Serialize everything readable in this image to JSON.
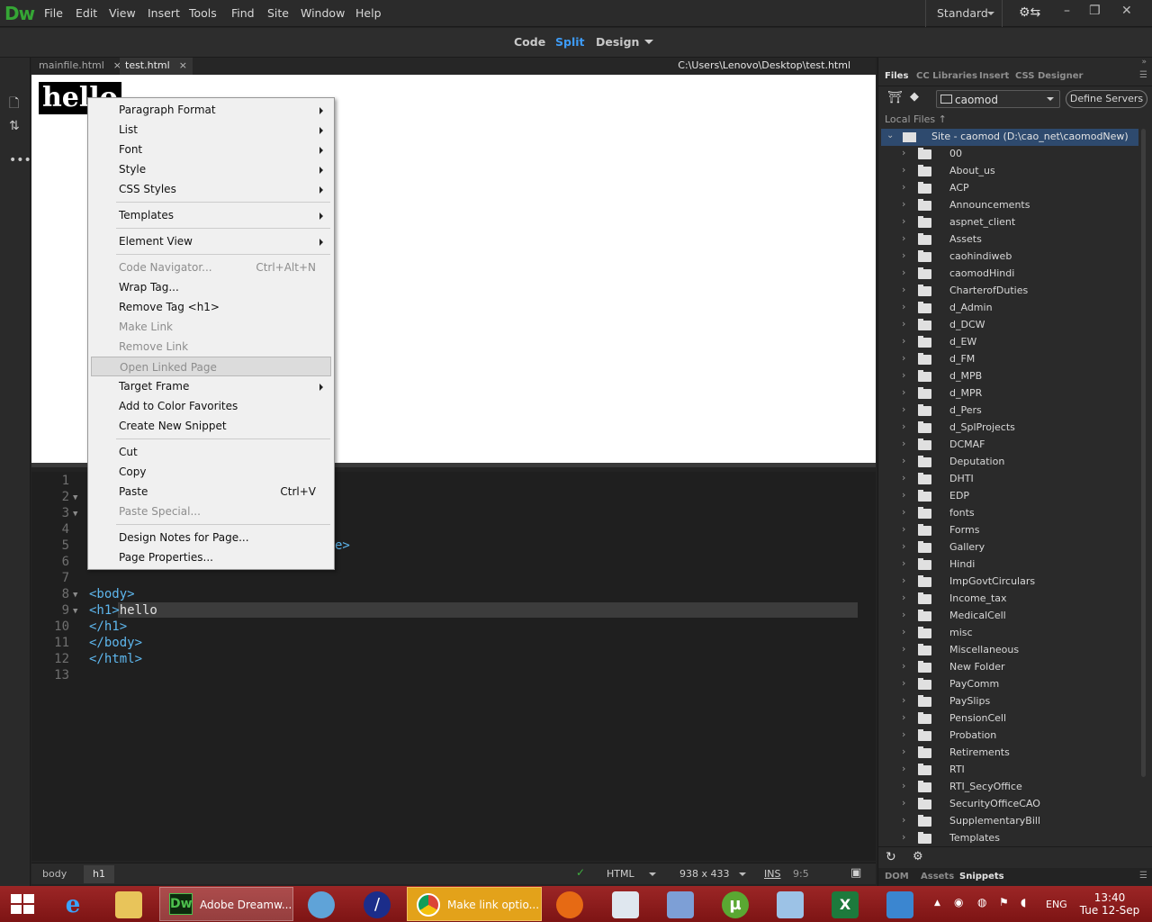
{
  "app": {
    "logo": "Dw",
    "menu": [
      "File",
      "Edit",
      "View",
      "Insert",
      "Tools",
      "Find",
      "Site",
      "Window",
      "Help"
    ],
    "workspace": "Standard",
    "window_buttons": [
      "–",
      "❐",
      "✕"
    ]
  },
  "viewbar": {
    "code": "Code",
    "split": "Split",
    "design": "Design"
  },
  "tabs": [
    {
      "label": "mainfile.html",
      "close": "×"
    },
    {
      "label": "test.html",
      "close": "×"
    }
  ],
  "filepath": "C:\\Users\\Lenovo\\Desktop\\test.html",
  "design_view": {
    "heading": "hello"
  },
  "code_view": {
    "line_numbers": [
      "1",
      "2",
      "3",
      "4",
      "5",
      "6",
      "7",
      "8",
      "9",
      "10",
      "11",
      "12",
      "13"
    ],
    "fragment_line5": "e>",
    "lines": [
      {
        "tag": "<body>",
        "text": ""
      },
      {
        "tag": "<h1>",
        "text": "hello"
      },
      {
        "tag": "</h1>",
        "text": ""
      },
      {
        "tag": "</body>",
        "text": ""
      },
      {
        "tag": "</html>",
        "text": ""
      }
    ]
  },
  "context_menu": [
    {
      "label": "Paragraph Format",
      "submenu": true
    },
    {
      "label": "List",
      "submenu": true
    },
    {
      "label": "Font",
      "submenu": true
    },
    {
      "label": "Style",
      "submenu": true
    },
    {
      "label": "CSS Styles",
      "submenu": true
    },
    {
      "label": "Templates",
      "submenu": true
    },
    {
      "label": "Element View",
      "submenu": true
    },
    {
      "label": "Code Navigator...",
      "shortcut": "Ctrl+Alt+N",
      "disabled": true
    },
    {
      "label": "Wrap Tag..."
    },
    {
      "label": "Remove Tag <h1>"
    },
    {
      "label": "Make Link",
      "disabled": true
    },
    {
      "label": "Remove Link",
      "disabled": true
    },
    {
      "label": "Open Linked Page",
      "disabled": true,
      "hover": true
    },
    {
      "label": "Target Frame",
      "submenu": true
    },
    {
      "label": "Add to Color Favorites"
    },
    {
      "label": "Create New Snippet"
    },
    {
      "label": "Cut"
    },
    {
      "label": "Copy"
    },
    {
      "label": "Paste",
      "shortcut": "Ctrl+V"
    },
    {
      "label": "Paste Special...",
      "disabled": true
    },
    {
      "label": "Design Notes for Page..."
    },
    {
      "label": "Page Properties..."
    }
  ],
  "status": {
    "tags": [
      "body",
      "h1"
    ],
    "doc_type": "HTML",
    "window_size": "938 x 433",
    "mode": "INS",
    "position": "9:5"
  },
  "files_panel": {
    "tabs": [
      "Files",
      "CC Libraries",
      "Insert",
      "CSS Designer"
    ],
    "site": "caomod",
    "define_servers": "Define Servers",
    "local_files": "Local Files",
    "site_root": "Site - caomod (D:\\cao_net\\caomodNew)",
    "folders": [
      "00",
      "About_us",
      "ACP",
      "Announcements",
      "aspnet_client",
      "Assets",
      "caohindiweb",
      "caomodHindi",
      "CharterofDuties",
      "d_Admin",
      "d_DCW",
      "d_EW",
      "d_FM",
      "d_MPB",
      "d_MPR",
      "d_Pers",
      "d_SplProjects",
      "DCMAF",
      "Deputation",
      "DHTI",
      "EDP",
      "fonts",
      "Forms",
      "Gallery",
      "Hindi",
      "ImpGovtCirculars",
      "Income_tax",
      "MedicalCell",
      "misc",
      "Miscellaneous",
      "New Folder",
      "PayComm",
      "PaySlips",
      "PensionCell",
      "Probation",
      "Retirements",
      "RTI",
      "RTI_SecyOffice",
      "SecurityOfficeCAO",
      "SupplementaryBill",
      "Templates"
    ],
    "footer_tabs": [
      "DOM",
      "Assets",
      "Snippets"
    ]
  },
  "taskbar": {
    "apps": [
      "Adobe Dreamw...",
      "Make link optio..."
    ],
    "language": "ENG",
    "time": "13:40",
    "date": "Tue 12-Sep"
  }
}
